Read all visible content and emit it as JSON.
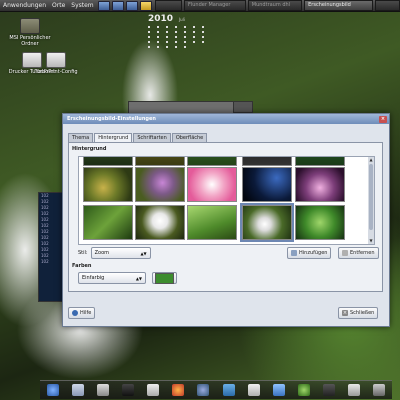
{
  "top_panel": {
    "menus": [
      "Anwendungen",
      "Orte",
      "System"
    ],
    "tasks": [
      {
        "label": "",
        "active": false
      },
      {
        "label": "Flunder Manager",
        "active": false
      },
      {
        "label": "Mundtraum dhl",
        "active": false
      },
      {
        "label": "Erscheinungsbild",
        "active": true
      }
    ]
  },
  "desktop_icons": [
    {
      "label": "MSI",
      "sublabel": "Persönlicher Ordner",
      "icon": "folder-icon"
    },
    {
      "label": "Drucker TurboPrint",
      "sublabel": "TurboPrint-Config",
      "icon": "printer-icon"
    }
  ],
  "calendar": {
    "year": "2010",
    "month": "Juli"
  },
  "dialog": {
    "title": "Erscheinungsbild-Einstellungen",
    "tabs": [
      "Thema",
      "Hintergrund",
      "Schriftarten",
      "Oberfläche"
    ],
    "active_tab": "Hintergrund",
    "section_background": "Hintergrund",
    "style_label": "Stil:",
    "style_value": "Zoom",
    "add_button": "Hinzufügen",
    "remove_button": "Entfernen",
    "colors_label": "Farben",
    "color_mode": "Einfarbig",
    "color_value": "#3c8c2e",
    "help_button": "Hilfe",
    "close_button": "Schließen"
  },
  "accent": "#6f8db9"
}
